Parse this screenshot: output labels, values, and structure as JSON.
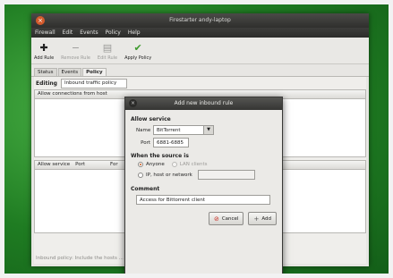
{
  "window": {
    "title": "Firestarter andy-laptop"
  },
  "menu": [
    "Firewall",
    "Edit",
    "Events",
    "Policy",
    "Help"
  ],
  "toolbar": {
    "add_rule": "Add Rule",
    "remove_rule": "Remove Rule",
    "edit_rule": "Edit Rule",
    "apply_policy": "Apply Policy"
  },
  "tabs": [
    "Status",
    "Events",
    "Policy"
  ],
  "policy": {
    "editing_label": "Editing",
    "editing_value": "Inbound traffic policy",
    "allow_connections_header": "Allow connections from host",
    "allow_service_cols": [
      "Allow service",
      "Port",
      "For"
    ],
    "status_hint": "Inbound policy: Include the hosts ..."
  },
  "dialog": {
    "title": "Add new inbound rule",
    "allow_service_heading": "Allow service",
    "name_label": "Name",
    "name_value": "BitTorrent",
    "port_label": "Port",
    "port_value": "6881-6885",
    "source_heading": "When the source is",
    "opt_anyone": "Anyone",
    "opt_lan": "LAN clients",
    "opt_host": "IP, host or network",
    "comment_heading": "Comment",
    "comment_value": "Access for Bittorrent client",
    "cancel_label": "Cancel",
    "add_label": "Add"
  },
  "colors": {
    "accent_radio": "#c65a1e",
    "cancel_icon": "#c92a1f"
  }
}
